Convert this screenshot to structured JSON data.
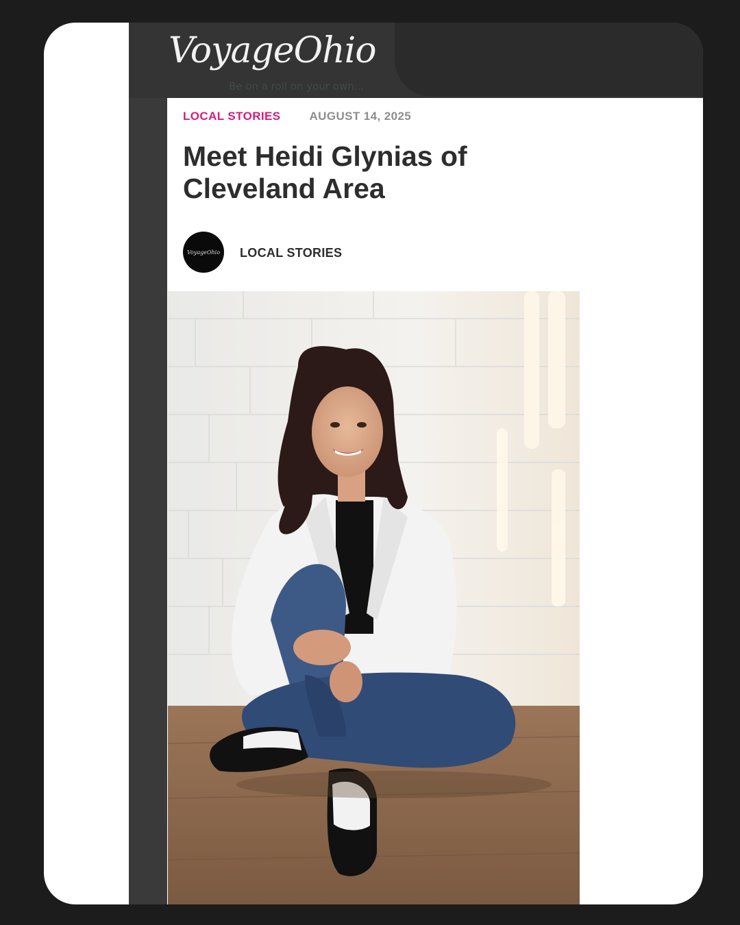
{
  "site": {
    "logo_text": "VoyageOhio",
    "faint_subtext": "Be on a roll on your own..."
  },
  "article": {
    "category": "LOCAL STORIES",
    "date": "AUGUST 14, 2025",
    "title": "Meet Heidi Glynias of Cleveland Area",
    "author_avatar_text": "VoyageOhio",
    "author_label": "LOCAL STORIES",
    "photo_alt": "Woman in white blazer, dark top, jeans and black-and-white saddle shoes sitting on a wooden floor against a white brick wall"
  },
  "colors": {
    "category": "#d41c7c",
    "date": "#8d8d8d",
    "title": "#2d2d2d",
    "background": "#1c1c1c",
    "header_bar": "#343434"
  }
}
